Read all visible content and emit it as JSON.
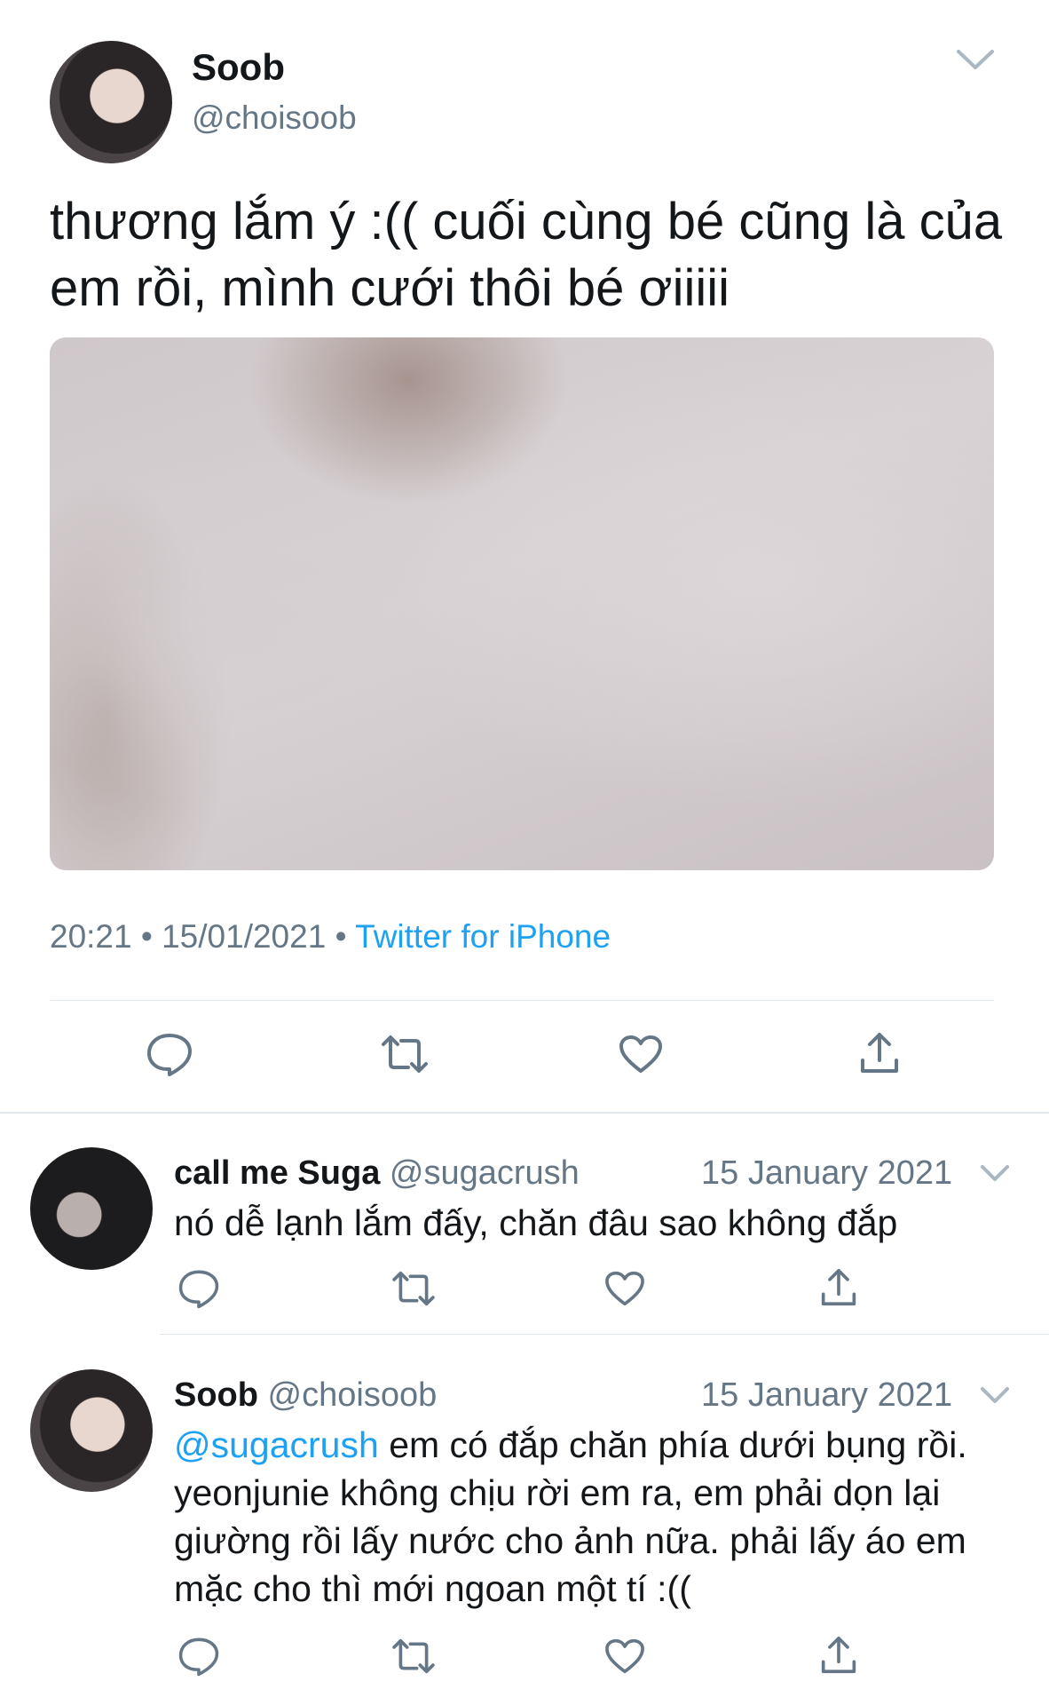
{
  "main_tweet": {
    "name": "Soob",
    "handle": "@choisoob",
    "text": "thương lắm ý :(( cuối cùng bé cũng là của em rồi, mình cưới thôi bé ơiiiii",
    "time": "20:21",
    "date": "15/01/2021",
    "source": "Twitter for iPhone",
    "avatar_icon": "profile-photo",
    "media_icon": "photo-attachment"
  },
  "actions": {
    "reply_icon": "reply-icon",
    "retweet_icon": "retweet-icon",
    "like_icon": "heart-icon",
    "share_icon": "share-icon"
  },
  "replies": [
    {
      "name": "call me Suga",
      "handle": "@sugacrush",
      "date": "15 January 2021",
      "mention": "",
      "text": "nó dễ lạnh lắm đấy, chăn đâu sao không đắp"
    },
    {
      "name": "Soob",
      "handle": "@choisoob",
      "date": "15 January 2021",
      "mention": "@sugacrush",
      "text": " em có đắp chăn phía dưới bụng rồi. yeonjunie không chịu rời em ra, em phải dọn lại giường rồi lấy nước cho ảnh nữa. phải lấy áo em mặc cho thì mới ngoan một tí :(("
    }
  ],
  "colors": {
    "text": "#14171a",
    "secondary": "#657786",
    "accent": "#1da1f2",
    "divider": "#e1e8ed"
  }
}
